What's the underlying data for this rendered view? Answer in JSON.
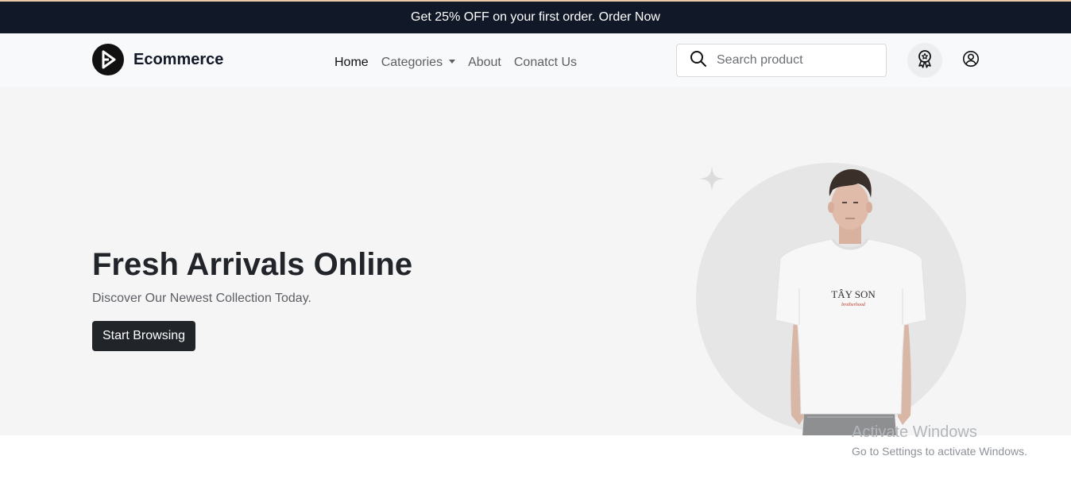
{
  "announcement": {
    "text": "Get 25% OFF on your first order. Order Now"
  },
  "brand": {
    "name": "Ecommerce",
    "logo_icon": "play-logo-icon"
  },
  "nav": {
    "items": [
      {
        "label": "Home",
        "active": true
      },
      {
        "label": "Categories",
        "dropdown": true
      },
      {
        "label": "About"
      },
      {
        "label": "Conatct Us"
      }
    ]
  },
  "search": {
    "placeholder": "Search product",
    "icon": "search-icon"
  },
  "actions": {
    "badge_icon": "award-icon",
    "user_icon": "user-circle-icon"
  },
  "hero": {
    "title": "Fresh Arrivals Online",
    "subtitle": "Discover Our Newest Collection Today.",
    "cta_label": "Start Browsing",
    "image": {
      "shirt_print": "TÂY SON",
      "shirt_print_sub": "brotherhood"
    }
  },
  "watermark": {
    "title": "Activate Windows",
    "subtitle": "Go to Settings to activate Windows."
  },
  "colors": {
    "announcement_bg": "#111827",
    "hero_bg": "#f5f5f6",
    "cta_bg": "#212529",
    "navbar_bg": "#f8f9fa"
  }
}
